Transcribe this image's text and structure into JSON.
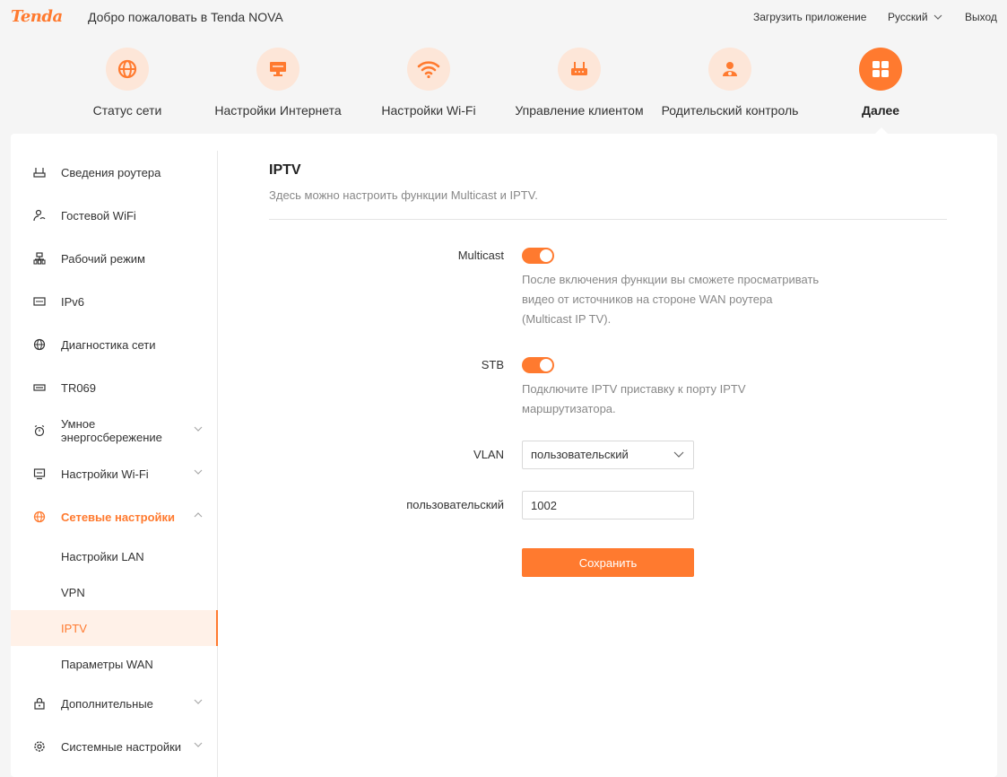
{
  "header": {
    "logo": "Tenda",
    "welcome": "Добро пожаловать в Tenda NOVA",
    "download_app": "Загрузить приложение",
    "language": "Русский",
    "logout": "Выход"
  },
  "colors": {
    "accent": "#ff7a2f",
    "accent_light": "#fde6d8"
  },
  "nav": [
    {
      "label": "Статус сети",
      "icon": "globe-icon"
    },
    {
      "label": "Настройки Интернета",
      "icon": "monitor-icon"
    },
    {
      "label": "Настройки Wi-Fi",
      "icon": "wifi-icon"
    },
    {
      "label": "Управление клиентом",
      "icon": "router-icon"
    },
    {
      "label": "Родительский контроль",
      "icon": "user-shield-icon"
    },
    {
      "label": "Далее",
      "icon": "grid-icon",
      "active": true
    }
  ],
  "sidebar": {
    "items": [
      {
        "label": "Сведения роутера"
      },
      {
        "label": "Гостевой WiFi"
      },
      {
        "label": "Рабочий режим"
      },
      {
        "label": "IPv6"
      },
      {
        "label": "Диагностика сети"
      },
      {
        "label": "TR069"
      },
      {
        "label_line1": "Умное",
        "label_line2": "энергосбережение"
      },
      {
        "label": "Настройки Wi-Fi"
      },
      {
        "label": "Сетевые настройки"
      },
      {
        "label": "Дополнительные"
      },
      {
        "label": "Системные настройки"
      }
    ],
    "sub_items": [
      {
        "label": "Настройки LAN"
      },
      {
        "label": "VPN"
      },
      {
        "label": "IPTV"
      },
      {
        "label": "Параметры WAN"
      }
    ]
  },
  "main": {
    "title": "IPTV",
    "description": "Здесь можно настроить функции Multicast и IPTV.",
    "multicast": {
      "label": "Multicast",
      "enabled": true,
      "hint_line1": "После включения функции вы сможете просматривать",
      "hint_line2": "видео от источников на стороне WAN роутера",
      "hint_line3": "(Multicast IP TV)."
    },
    "stb": {
      "label": "STB",
      "enabled": true,
      "hint_line1": "Подключите IPTV приставку к порту IPTV",
      "hint_line2": "маршрутизатора."
    },
    "vlan": {
      "label": "VLAN",
      "selected": "пользовательский"
    },
    "custom": {
      "label": "пользовательский",
      "value": "1002"
    },
    "save_label": "Сохранить"
  }
}
